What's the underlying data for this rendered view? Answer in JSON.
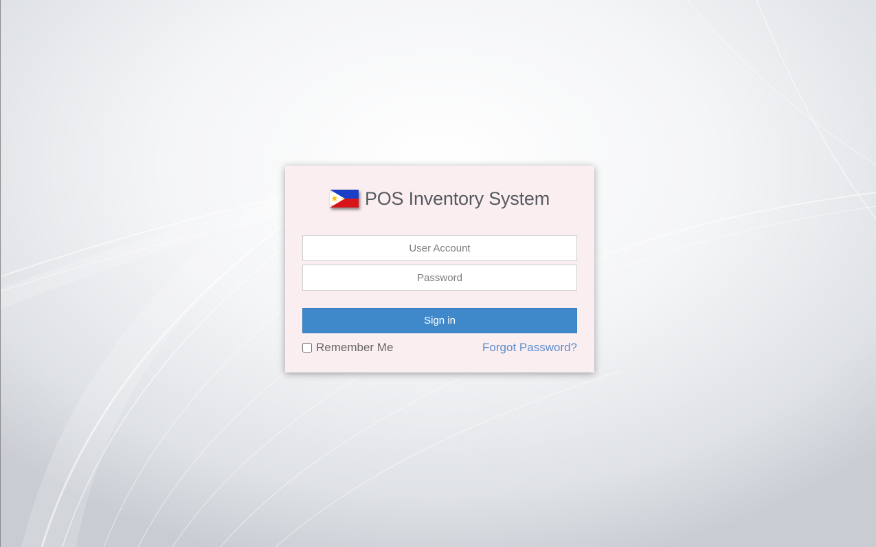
{
  "brand": {
    "title": "POS Inventory System",
    "flag_icon": "philippine-flag-icon"
  },
  "form": {
    "username_placeholder": "User Account",
    "username_value": "",
    "password_placeholder": "Password",
    "password_value": "",
    "signin_label": "Sign in",
    "remember_label": "Remember Me",
    "remember_checked": false,
    "forgot_label": "Forgot Password?"
  },
  "colors": {
    "card_background": "#fbeef0",
    "button_primary": "#3f89cb",
    "link": "#5b8ccc"
  }
}
